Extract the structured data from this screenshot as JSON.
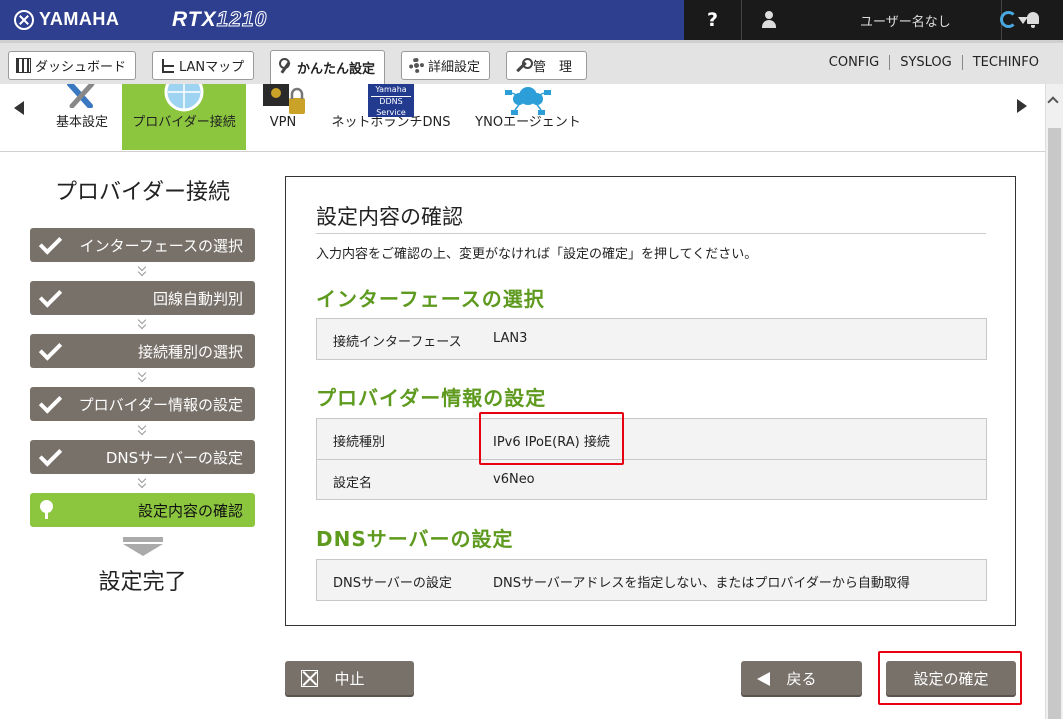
{
  "header": {
    "brand": "YAMAHA",
    "model_prefix": "RTX",
    "model_number": "1210",
    "help_label": "?",
    "user_name": "ユーザー名なし"
  },
  "menu": {
    "tabs": [
      {
        "label": "ダッシュボード",
        "icon": "dashboard-icon"
      },
      {
        "label": "LANマップ",
        "icon": "lan-map-icon"
      },
      {
        "label": "かんたん設定",
        "icon": "magic-wand-icon",
        "active": true
      },
      {
        "label": "詳細設定",
        "icon": "gear-icon"
      },
      {
        "label": "管　理",
        "icon": "wrench-icon"
      }
    ],
    "links": [
      "CONFIG",
      "SYSLOG",
      "TECHINFO"
    ]
  },
  "functions": [
    {
      "label": "基本設定",
      "icon": "tools-icon"
    },
    {
      "label": "プロバイダー接続",
      "icon": "globe-icon",
      "active": true
    },
    {
      "label": "VPN",
      "icon": "vpn-lock-icon"
    },
    {
      "label": "ネットボランチDNS",
      "icon": "ddns-icon",
      "badge_top": "Yamaha",
      "badge_mid": "DDNS",
      "badge_sub": "Service"
    },
    {
      "label": "YNOエージェント",
      "icon": "cloud-network-icon"
    }
  ],
  "wizard": {
    "title": "プロバイダー接続",
    "steps": [
      {
        "label": "インターフェースの選択",
        "state": "done"
      },
      {
        "label": "回線自動判別",
        "state": "done"
      },
      {
        "label": "接続種別の選択",
        "state": "done"
      },
      {
        "label": "プロバイダー情報の設定",
        "state": "done"
      },
      {
        "label": "DNSサーバーの設定",
        "state": "done"
      },
      {
        "label": "設定内容の確認",
        "state": "current"
      }
    ],
    "final": "設定完了"
  },
  "panel": {
    "title": "設定内容の確認",
    "description": "入力内容をご確認の上、変更がなければ「設定の確定」を押してください。",
    "sections": [
      {
        "heading": "インターフェースの選択",
        "rows": [
          {
            "key": "接続インターフェース",
            "value": "LAN3"
          }
        ]
      },
      {
        "heading": "プロバイダー情報の設定",
        "rows": [
          {
            "key": "接続種別",
            "value": "IPv6 IPoE(RA) 接続"
          },
          {
            "key": "設定名",
            "value": "v6Neo"
          }
        ]
      },
      {
        "heading": "DNSサーバーの設定",
        "rows": [
          {
            "key": "DNSサーバーの設定",
            "value": "DNSサーバーアドレスを指定しない、またはプロバイダーから自動取得"
          }
        ]
      }
    ]
  },
  "buttons": {
    "cancel": "中止",
    "back": "戻る",
    "confirm": "設定の確定"
  },
  "colors": {
    "header_bg": "#2e3f8f",
    "accent_green": "#8cc63f",
    "heading_green": "#5d9a1e",
    "step_gray": "#78716a",
    "highlight_red": "#e60012"
  }
}
